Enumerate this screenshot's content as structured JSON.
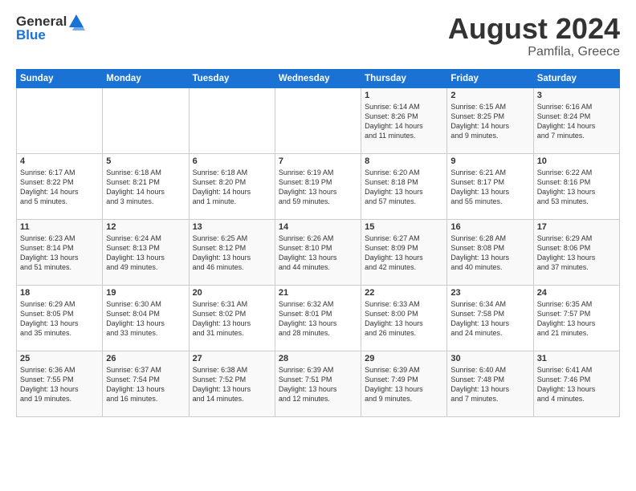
{
  "logo": {
    "general": "General",
    "blue": "Blue"
  },
  "title": "August 2024",
  "location": "Pamfila, Greece",
  "weekdays": [
    "Sunday",
    "Monday",
    "Tuesday",
    "Wednesday",
    "Thursday",
    "Friday",
    "Saturday"
  ],
  "weeks": [
    [
      {
        "day": "",
        "info": ""
      },
      {
        "day": "",
        "info": ""
      },
      {
        "day": "",
        "info": ""
      },
      {
        "day": "",
        "info": ""
      },
      {
        "day": "1",
        "info": "Sunrise: 6:14 AM\nSunset: 8:26 PM\nDaylight: 14 hours\nand 11 minutes."
      },
      {
        "day": "2",
        "info": "Sunrise: 6:15 AM\nSunset: 8:25 PM\nDaylight: 14 hours\nand 9 minutes."
      },
      {
        "day": "3",
        "info": "Sunrise: 6:16 AM\nSunset: 8:24 PM\nDaylight: 14 hours\nand 7 minutes."
      }
    ],
    [
      {
        "day": "4",
        "info": "Sunrise: 6:17 AM\nSunset: 8:22 PM\nDaylight: 14 hours\nand 5 minutes."
      },
      {
        "day": "5",
        "info": "Sunrise: 6:18 AM\nSunset: 8:21 PM\nDaylight: 14 hours\nand 3 minutes."
      },
      {
        "day": "6",
        "info": "Sunrise: 6:18 AM\nSunset: 8:20 PM\nDaylight: 14 hours\nand 1 minute."
      },
      {
        "day": "7",
        "info": "Sunrise: 6:19 AM\nSunset: 8:19 PM\nDaylight: 13 hours\nand 59 minutes."
      },
      {
        "day": "8",
        "info": "Sunrise: 6:20 AM\nSunset: 8:18 PM\nDaylight: 13 hours\nand 57 minutes."
      },
      {
        "day": "9",
        "info": "Sunrise: 6:21 AM\nSunset: 8:17 PM\nDaylight: 13 hours\nand 55 minutes."
      },
      {
        "day": "10",
        "info": "Sunrise: 6:22 AM\nSunset: 8:16 PM\nDaylight: 13 hours\nand 53 minutes."
      }
    ],
    [
      {
        "day": "11",
        "info": "Sunrise: 6:23 AM\nSunset: 8:14 PM\nDaylight: 13 hours\nand 51 minutes."
      },
      {
        "day": "12",
        "info": "Sunrise: 6:24 AM\nSunset: 8:13 PM\nDaylight: 13 hours\nand 49 minutes."
      },
      {
        "day": "13",
        "info": "Sunrise: 6:25 AM\nSunset: 8:12 PM\nDaylight: 13 hours\nand 46 minutes."
      },
      {
        "day": "14",
        "info": "Sunrise: 6:26 AM\nSunset: 8:10 PM\nDaylight: 13 hours\nand 44 minutes."
      },
      {
        "day": "15",
        "info": "Sunrise: 6:27 AM\nSunset: 8:09 PM\nDaylight: 13 hours\nand 42 minutes."
      },
      {
        "day": "16",
        "info": "Sunrise: 6:28 AM\nSunset: 8:08 PM\nDaylight: 13 hours\nand 40 minutes."
      },
      {
        "day": "17",
        "info": "Sunrise: 6:29 AM\nSunset: 8:06 PM\nDaylight: 13 hours\nand 37 minutes."
      }
    ],
    [
      {
        "day": "18",
        "info": "Sunrise: 6:29 AM\nSunset: 8:05 PM\nDaylight: 13 hours\nand 35 minutes."
      },
      {
        "day": "19",
        "info": "Sunrise: 6:30 AM\nSunset: 8:04 PM\nDaylight: 13 hours\nand 33 minutes."
      },
      {
        "day": "20",
        "info": "Sunrise: 6:31 AM\nSunset: 8:02 PM\nDaylight: 13 hours\nand 31 minutes."
      },
      {
        "day": "21",
        "info": "Sunrise: 6:32 AM\nSunset: 8:01 PM\nDaylight: 13 hours\nand 28 minutes."
      },
      {
        "day": "22",
        "info": "Sunrise: 6:33 AM\nSunset: 8:00 PM\nDaylight: 13 hours\nand 26 minutes."
      },
      {
        "day": "23",
        "info": "Sunrise: 6:34 AM\nSunset: 7:58 PM\nDaylight: 13 hours\nand 24 minutes."
      },
      {
        "day": "24",
        "info": "Sunrise: 6:35 AM\nSunset: 7:57 PM\nDaylight: 13 hours\nand 21 minutes."
      }
    ],
    [
      {
        "day": "25",
        "info": "Sunrise: 6:36 AM\nSunset: 7:55 PM\nDaylight: 13 hours\nand 19 minutes."
      },
      {
        "day": "26",
        "info": "Sunrise: 6:37 AM\nSunset: 7:54 PM\nDaylight: 13 hours\nand 16 minutes."
      },
      {
        "day": "27",
        "info": "Sunrise: 6:38 AM\nSunset: 7:52 PM\nDaylight: 13 hours\nand 14 minutes."
      },
      {
        "day": "28",
        "info": "Sunrise: 6:39 AM\nSunset: 7:51 PM\nDaylight: 13 hours\nand 12 minutes."
      },
      {
        "day": "29",
        "info": "Sunrise: 6:39 AM\nSunset: 7:49 PM\nDaylight: 13 hours\nand 9 minutes."
      },
      {
        "day": "30",
        "info": "Sunrise: 6:40 AM\nSunset: 7:48 PM\nDaylight: 13 hours\nand 7 minutes."
      },
      {
        "day": "31",
        "info": "Sunrise: 6:41 AM\nSunset: 7:46 PM\nDaylight: 13 hours\nand 4 minutes."
      }
    ]
  ]
}
